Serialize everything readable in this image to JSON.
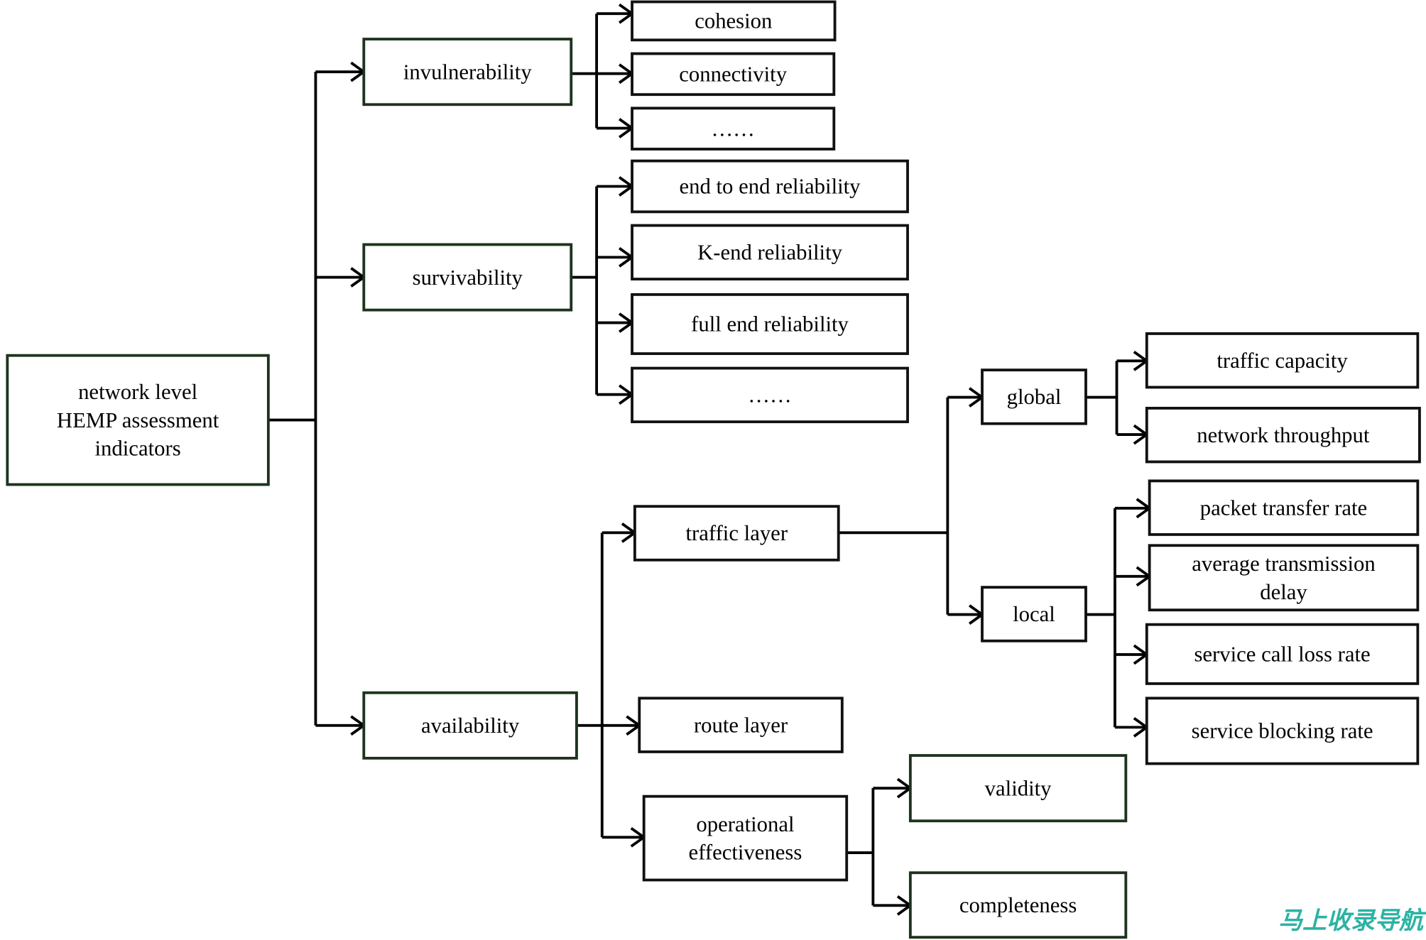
{
  "diagram": {
    "root": {
      "id": "root",
      "lines": [
        "network level",
        "HEMP assessment",
        "indicators"
      ]
    },
    "nodes": [
      {
        "id": "invulnerability",
        "lines": [
          "invulnerability"
        ]
      },
      {
        "id": "survivability",
        "lines": [
          "survivability"
        ]
      },
      {
        "id": "availability",
        "lines": [
          "availability"
        ]
      },
      {
        "id": "cohesion",
        "lines": [
          "cohesion"
        ]
      },
      {
        "id": "connectivity",
        "lines": [
          "connectivity"
        ]
      },
      {
        "id": "ellipsis-1",
        "lines": [
          "……"
        ]
      },
      {
        "id": "end-to-end-reliability",
        "lines": [
          "end to end reliability"
        ]
      },
      {
        "id": "k-end-reliability",
        "lines": [
          "K-end reliability"
        ]
      },
      {
        "id": "full-end-reliability",
        "lines": [
          "full end reliability"
        ]
      },
      {
        "id": "ellipsis-2",
        "lines": [
          "……"
        ]
      },
      {
        "id": "traffic-layer",
        "lines": [
          "traffic layer"
        ]
      },
      {
        "id": "route-layer",
        "lines": [
          "route layer"
        ]
      },
      {
        "id": "operational-effectiveness",
        "lines": [
          "operational",
          "effectiveness"
        ]
      },
      {
        "id": "global",
        "lines": [
          "global"
        ]
      },
      {
        "id": "local",
        "lines": [
          "local"
        ]
      },
      {
        "id": "traffic-capacity",
        "lines": [
          "traffic capacity"
        ]
      },
      {
        "id": "network-throughput",
        "lines": [
          "network throughput"
        ]
      },
      {
        "id": "packet-transfer-rate",
        "lines": [
          "packet transfer rate"
        ]
      },
      {
        "id": "average-transmission-delay",
        "lines": [
          "average transmission",
          "delay"
        ]
      },
      {
        "id": "service-call-loss-rate",
        "lines": [
          "service call loss rate"
        ]
      },
      {
        "id": "service-blocking-rate",
        "lines": [
          "service blocking rate"
        ]
      },
      {
        "id": "validity",
        "lines": [
          "validity"
        ]
      },
      {
        "id": "completeness",
        "lines": [
          "completeness"
        ]
      }
    ],
    "edges": [
      [
        "root",
        "invulnerability"
      ],
      [
        "root",
        "survivability"
      ],
      [
        "root",
        "availability"
      ],
      [
        "invulnerability",
        "cohesion"
      ],
      [
        "invulnerability",
        "connectivity"
      ],
      [
        "invulnerability",
        "ellipsis-1"
      ],
      [
        "survivability",
        "end-to-end-reliability"
      ],
      [
        "survivability",
        "k-end-reliability"
      ],
      [
        "survivability",
        "full-end-reliability"
      ],
      [
        "survivability",
        "ellipsis-2"
      ],
      [
        "availability",
        "traffic-layer"
      ],
      [
        "availability",
        "route-layer"
      ],
      [
        "availability",
        "operational-effectiveness"
      ],
      [
        "traffic-layer",
        "global"
      ],
      [
        "traffic-layer",
        "local"
      ],
      [
        "global",
        "traffic-capacity"
      ],
      [
        "global",
        "network-throughput"
      ],
      [
        "local",
        "packet-transfer-rate"
      ],
      [
        "local",
        "average-transmission-delay"
      ],
      [
        "local",
        "service-call-loss-rate"
      ],
      [
        "local",
        "service-blocking-rate"
      ],
      [
        "operational-effectiveness",
        "validity"
      ],
      [
        "operational-effectiveness",
        "completeness"
      ]
    ]
  },
  "watermark": "马上收录导航"
}
